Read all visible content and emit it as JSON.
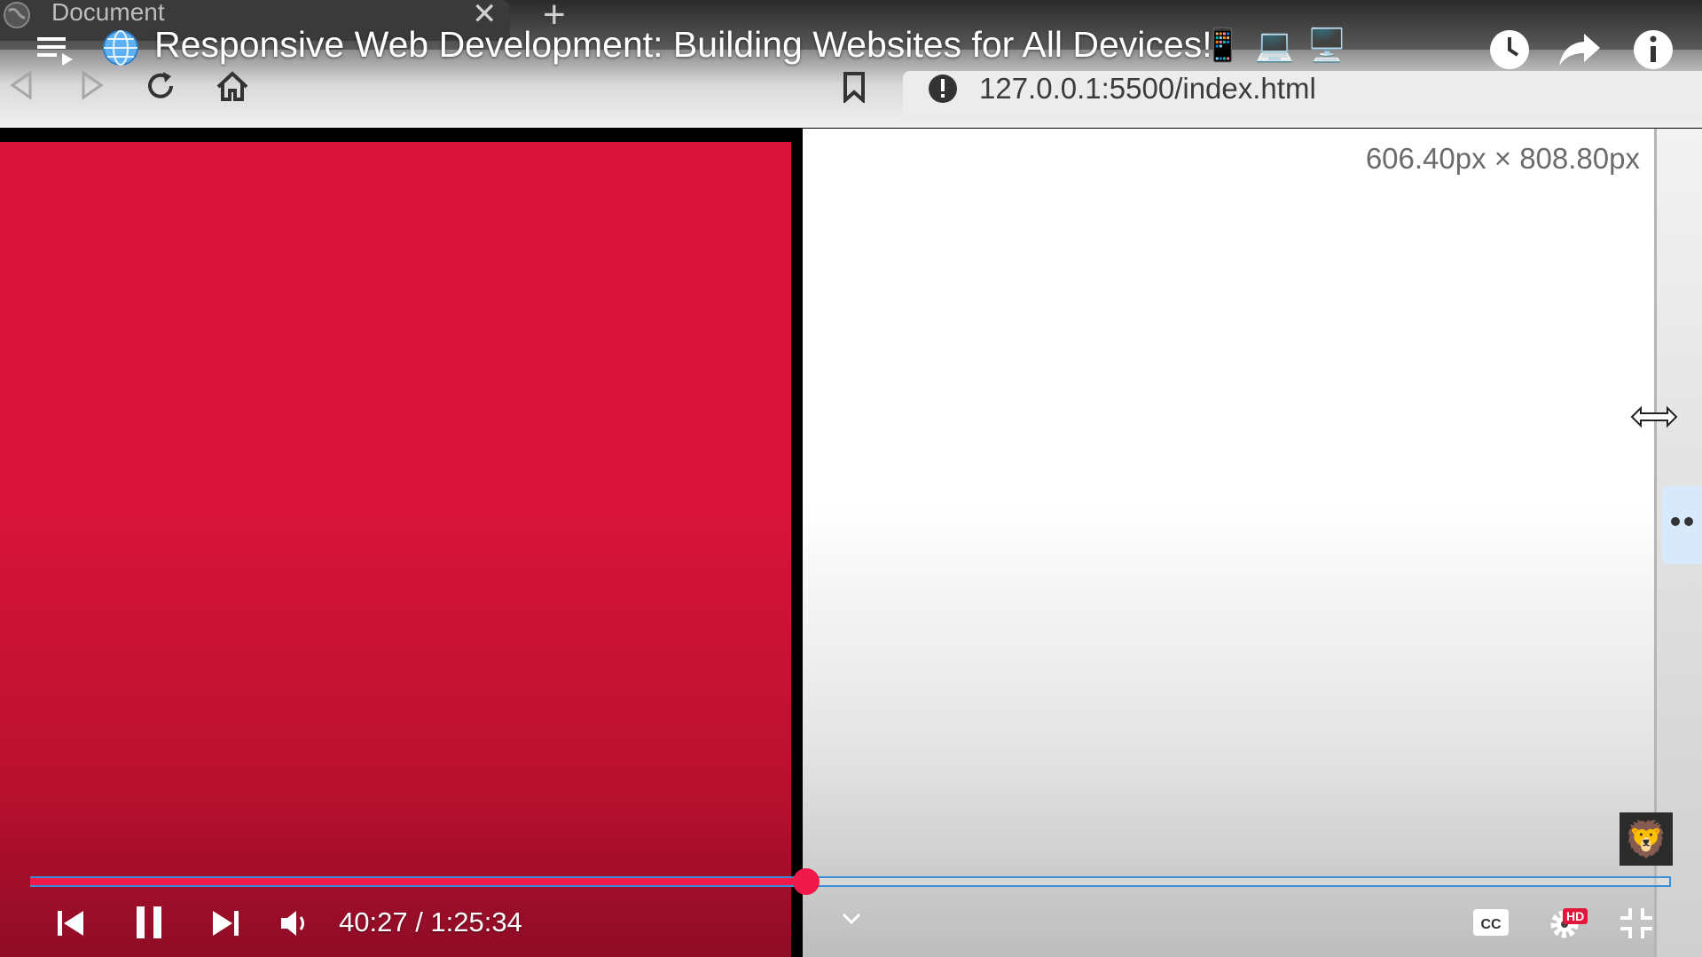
{
  "browser": {
    "tab": {
      "title": "Document"
    },
    "address_bar": {
      "url": "127.0.0.1:5500/index.html"
    }
  },
  "viewport": {
    "dimensions_label": "606.40px × 808.80px"
  },
  "video": {
    "title": "Responsive Web Development: Building Websites for All Devices!",
    "title_emojis": [
      "📱",
      "💻",
      "🖥️"
    ],
    "time": {
      "current": "40:27",
      "duration": "1:25:34",
      "separator": " / "
    },
    "progress_fraction": 0.4728,
    "buffered_fraction": 0.4755,
    "hd_badge": "HD",
    "channel_avatar": "🦁"
  },
  "colors": {
    "content_red": "#d9143b",
    "progress_played": "#f1184a",
    "progress_outline": "#3a8ed8"
  },
  "icons": {
    "globe": "globe-icon",
    "playlist": "playlist-icon",
    "watch_later": "clock-icon",
    "share": "share-icon",
    "info": "info-icon",
    "cc": "cc-icon",
    "settings": "gear-icon",
    "fullscreen_exit": "exit-fullscreen-icon"
  }
}
